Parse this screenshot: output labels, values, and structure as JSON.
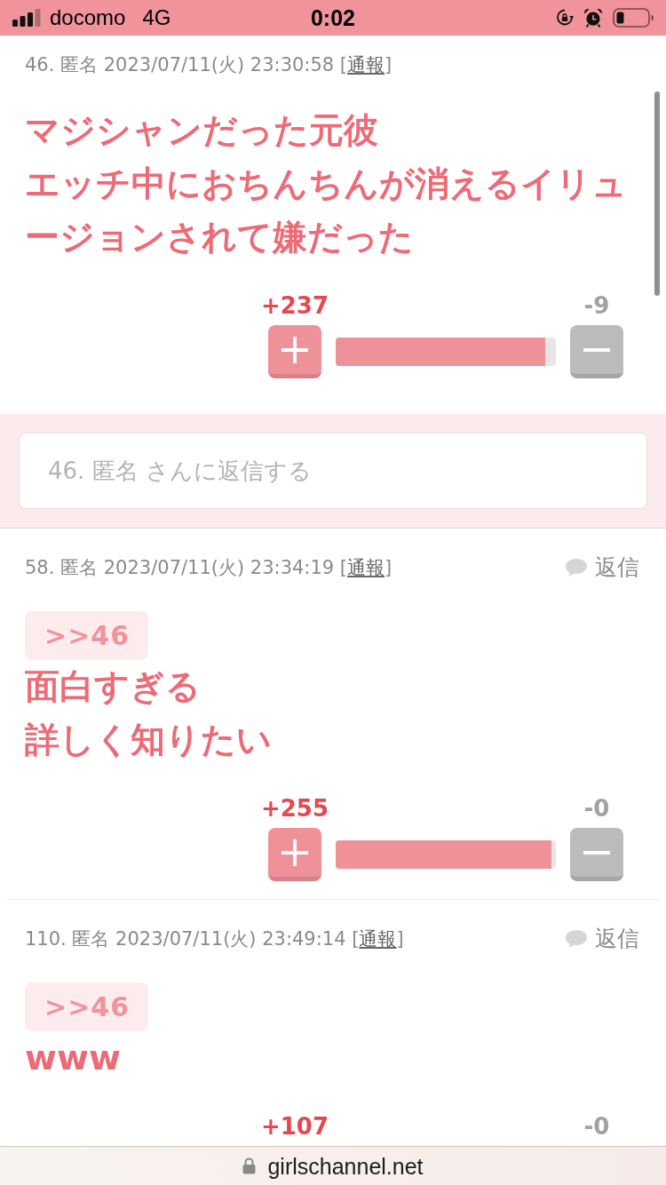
{
  "status_bar": {
    "carrier": "docomo",
    "network": "4G",
    "time": "0:02"
  },
  "posts": [
    {
      "number": "46.",
      "author": "匿名",
      "posted": "2023/07/11(火) 23:30:58",
      "bracket_open": "[",
      "report_link": "通報",
      "bracket_close": "]",
      "body": [
        "マジシャンだった元彼",
        "エッチ中におちんちんが消えるイリュージョンされて嫌だった"
      ],
      "votes": {
        "plus": "+237",
        "minus": "-9",
        "level": 0.95
      },
      "reply_form": {
        "placeholder": "46. 匿名 さんに返信する"
      }
    },
    {
      "number": "58.",
      "author": "匿名",
      "posted": "2023/07/11(火) 23:34:19",
      "bracket_open": "[",
      "report_link": "通報",
      "bracket_close": "]",
      "reply_button": "返信",
      "anchor": ">>46",
      "body": [
        "面白すぎる",
        "詳しく知りたい"
      ],
      "votes": {
        "plus": "+255",
        "minus": "-0",
        "level": 0.98
      }
    },
    {
      "number": "110.",
      "author": "匿名",
      "posted": "2023/07/11(火) 23:49:14",
      "bracket_open": "[",
      "report_link": "通報",
      "bracket_close": "]",
      "reply_button": "返信",
      "anchor": ">>46",
      "body": [
        "www"
      ],
      "votes": {
        "plus": "+107",
        "minus": "-0"
      }
    }
  ],
  "address_bar": {
    "url": "girlschannel.net"
  }
}
